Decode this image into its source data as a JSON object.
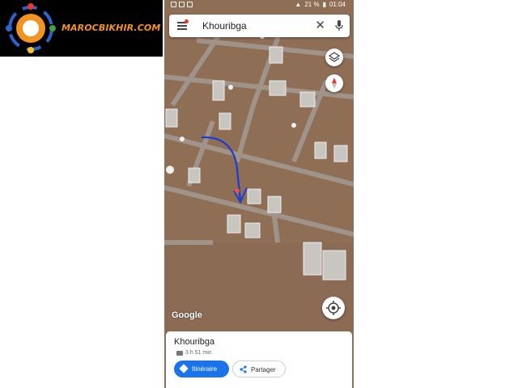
{
  "watermark": {
    "text": "MAROCBIKHIR.COM"
  },
  "status_bar": {
    "battery": "21 %",
    "time": "01:04"
  },
  "search": {
    "query": "Khouribga",
    "menu_icon": "hamburger-menu-icon",
    "clear_icon": "close-icon",
    "mic_icon": "microphone-icon"
  },
  "map": {
    "attribution": "Google",
    "type": "satellite",
    "annotation_color": "#1a3bd6"
  },
  "controls": {
    "layers_icon": "layers-icon",
    "compass_icon": "compass-icon",
    "location_icon": "my-location-icon"
  },
  "place_card": {
    "title": "Khouribga",
    "travel_time": "3 h 51 min",
    "travel_mode_icon": "car-icon",
    "route_label": "Itinéraire",
    "share_label": "Partager"
  },
  "colors": {
    "accent": "#1a73e8",
    "logo_text": "#f29422"
  }
}
